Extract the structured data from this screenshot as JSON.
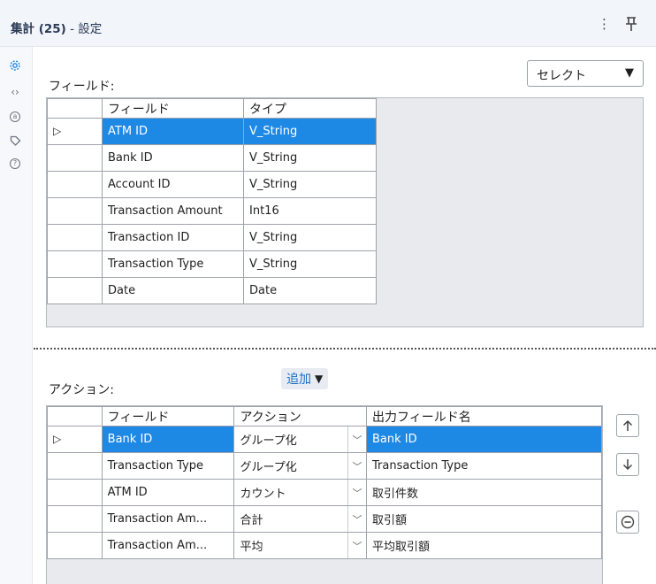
{
  "header": {
    "title_main": "集計 (25)",
    "title_sep": " - ",
    "title_sub": "設定",
    "more_icon": "⋮",
    "pin_icon": "ㅍ"
  },
  "rail": {
    "icons": [
      "gear-icon",
      "code-icon",
      "annotation-icon",
      "tag-icon",
      "help-icon"
    ]
  },
  "fields_section": {
    "label": "フィールド:",
    "select_value": "セレクト",
    "columns": [
      "フィールド",
      "タイプ"
    ],
    "rows": [
      {
        "field": "ATM ID",
        "type": "V_String",
        "selected": true
      },
      {
        "field": "Bank ID",
        "type": "V_String"
      },
      {
        "field": "Account ID",
        "type": "V_String"
      },
      {
        "field": "Transaction Amount",
        "type": "Int16"
      },
      {
        "field": "Transaction ID",
        "type": "V_String"
      },
      {
        "field": "Transaction Type",
        "type": "V_String"
      },
      {
        "field": "Date",
        "type": "Date"
      }
    ]
  },
  "actions_section": {
    "label": "アクション:",
    "add_label": "追加",
    "columns": [
      "フィールド",
      "アクション",
      "出力フィールド名"
    ],
    "rows": [
      {
        "field": "Bank ID",
        "action": "グループ化",
        "output": "Bank ID",
        "selected": true
      },
      {
        "field": "Transaction Type",
        "action": "グループ化",
        "output": "Transaction Type"
      },
      {
        "field": "ATM ID",
        "action": "カウント",
        "output": "取引件数"
      },
      {
        "field": "Transaction Am...",
        "action": "合計",
        "output": "取引額"
      },
      {
        "field": "Transaction Am...",
        "action": "平均",
        "output": "平均取引額"
      }
    ]
  },
  "colors": {
    "selection": "#1e88e5",
    "accent": "#1e6ec8"
  }
}
